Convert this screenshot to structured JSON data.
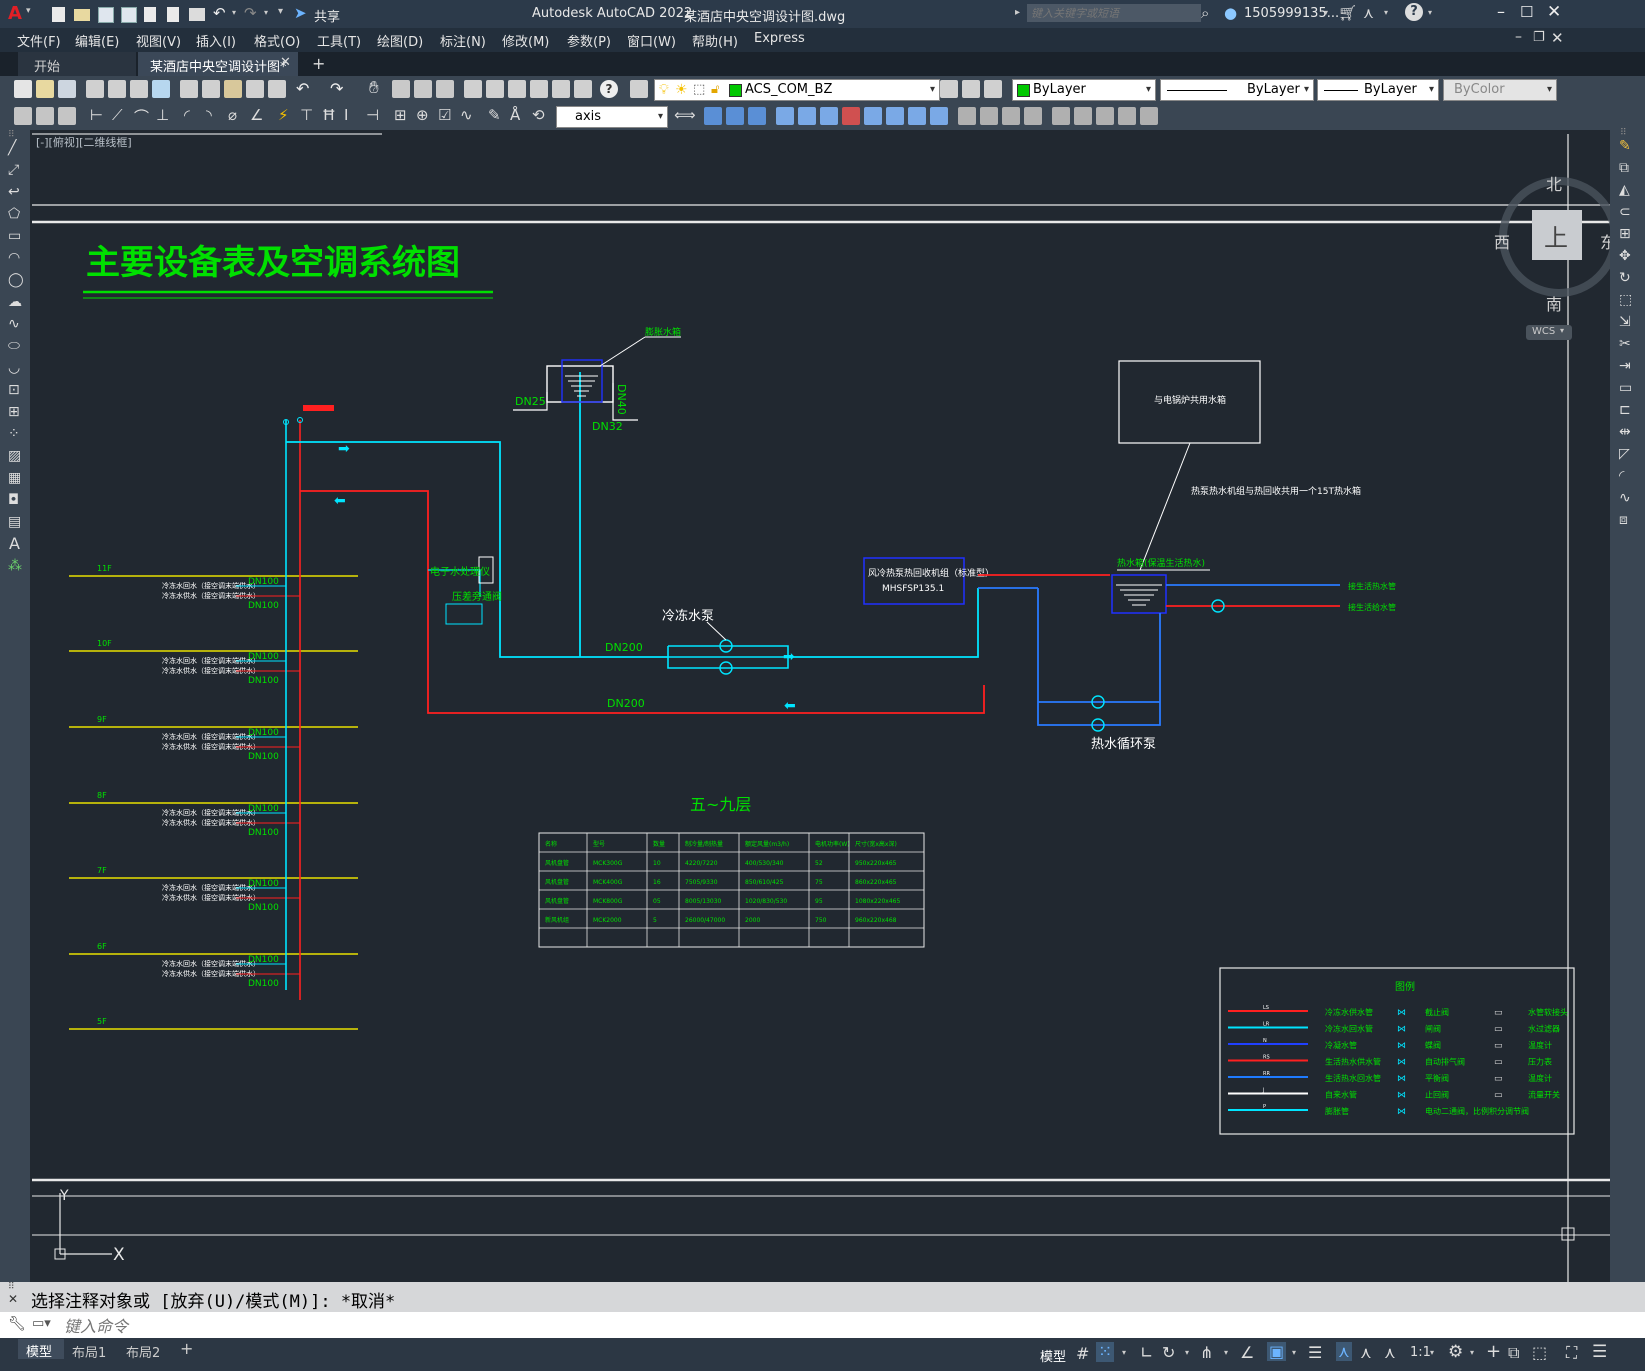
{
  "title_bar": {
    "app_title": "Autodesk AutoCAD 2022",
    "file_title": "某酒店中央空调设计图.dwg",
    "share_label": "共享",
    "search_placeholder": "键入关键字或短语",
    "user_name": "1505999135...",
    "window_controls": [
      "minimize-icon",
      "maximize-icon",
      "close-icon"
    ]
  },
  "menu": [
    "文件(F)",
    "编辑(E)",
    "视图(V)",
    "插入(I)",
    "格式(O)",
    "工具(T)",
    "绘图(D)",
    "标注(N)",
    "修改(M)",
    "参数(P)",
    "窗口(W)",
    "帮助(H)",
    "Express"
  ],
  "tabs": {
    "start": "开始",
    "active": "某酒店中央空调设计图*",
    "add": "+"
  },
  "toolbar": {
    "layer_name": "ACS_COM_BZ",
    "layer_color": "#00c800",
    "color_value": "ByLayer",
    "linetype_value": "ByLayer",
    "lineweight_value": "ByLayer",
    "plotstyle_value": "ByColor",
    "dim_style": "axis"
  },
  "viewport_label": "[-][俯视][二维线框]",
  "viewcube": {
    "north": "北",
    "south": "南",
    "east": "东",
    "west": "西",
    "face": "上",
    "wcs": "WCS"
  },
  "drawing": {
    "main_title": "主要设备表及空调系统图",
    "floors": [
      "11F",
      "10F",
      "9F",
      "8F",
      "7F",
      "6F",
      "5F"
    ],
    "riser_labels": [
      "DN100",
      "DN100"
    ],
    "riser_notes": [
      "冷冻水回水（接空调末端供水）",
      "冷冻水供水（接空调末端供水）"
    ],
    "labels": {
      "makeup_water": "膨胀水箱",
      "dn25": "DN25",
      "dn32": "DN32",
      "dn40": "DN40",
      "descaler": "电子水处理仪",
      "pressure_device": "压差旁通阀",
      "chilled_pump": "冷冻水泵",
      "dn200_supply": "DN200",
      "dn200_return": "DN200",
      "heat_pump_unit": "风冷热泵热回收机组（标准型）",
      "unit_model": "MHSFSP135.1",
      "hot_tank_box": "与电锅炉共用水箱",
      "hot_tank_note": "热泵热水机组与热回收共用一个15T热水箱",
      "hot_tank_label": "热水箱(保温生活热水)",
      "hot_pump": "热水循环泵",
      "domestic_out1": "接生活热水管",
      "domestic_out2": "接生活给水管",
      "section_title": "五~九层"
    },
    "equipment_table": {
      "headers": [
        "名称",
        "型号",
        "数量",
        "制冷量/制热量",
        "额定风量(m3/h)",
        "电机功率(W)",
        "尺寸(宽x高x深)"
      ],
      "rows": [
        [
          "风机盘管",
          "MCK300G",
          "10",
          "4220/7220",
          "400/530/340",
          "52",
          "950x220x465"
        ],
        [
          "风机盘管",
          "MCK400G",
          "16",
          "7505/9330",
          "850/610/425",
          "75",
          "860x220x465"
        ],
        [
          "风机盘管",
          "MCK800G",
          "05",
          "8005/13030",
          "1020/830/530",
          "95",
          "1080x220x465"
        ],
        [
          "新风机组",
          "MCK2000",
          "5",
          "26000/47000",
          "2000",
          "750",
          "960x220x468"
        ],
        [
          "",
          "",
          "",
          "",
          "",
          "",
          ""
        ]
      ]
    },
    "legend": {
      "title": "图例",
      "lines": [
        {
          "code": "LS",
          "color": "#ff2020",
          "label": "冷冻水供水管"
        },
        {
          "code": "LR",
          "color": "#00e5ff",
          "label": "冷冻水回水管"
        },
        {
          "code": "N",
          "color": "#2040ff",
          "label": "冷凝水管"
        },
        {
          "code": "RS",
          "color": "#ff2020",
          "label": "生活热水供水管"
        },
        {
          "code": "RR",
          "color": "#1e7bff",
          "label": "生活热水回水管"
        },
        {
          "code": "J",
          "color": "#ffffff",
          "label": "自来水管"
        },
        {
          "code": "P",
          "color": "#00e5ff",
          "label": "膨胀管"
        }
      ],
      "symbols_mid": [
        "截止阀",
        "闸阀",
        "蝶阀",
        "自动排气阀",
        "平衡阀",
        "止回阀",
        "电动二通阀，比例积分调节阀"
      ],
      "symbols_right": [
        "水管软接头",
        "水过滤器",
        "温度计",
        "压力表",
        "温度计",
        "流量开关"
      ]
    },
    "ucs": {
      "x": "X",
      "y": "Y"
    }
  },
  "command": {
    "history": "选择注释对象或 [放弃(U)/模式(M)]: *取消*",
    "placeholder": "键入命令"
  },
  "layout_tabs": [
    "模型",
    "布局1",
    "布局2",
    "+"
  ],
  "status": {
    "model_label": "模型",
    "scale": "1:1"
  }
}
